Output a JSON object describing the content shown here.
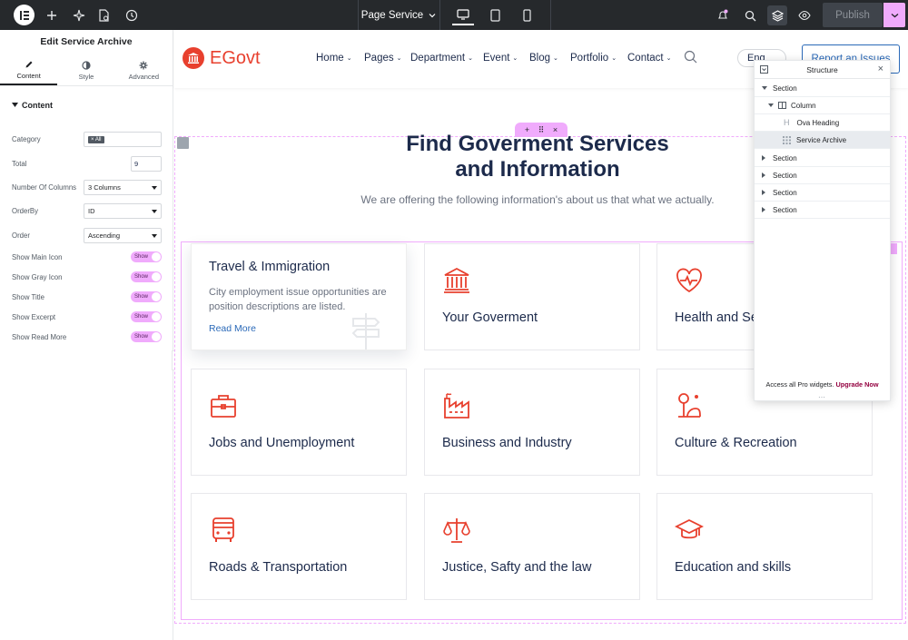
{
  "topbar": {
    "page_name": "Page Service",
    "publish_label": "Publish",
    "icons": [
      "elementor-logo-icon",
      "add-icon",
      "ai-icon",
      "page-settings-icon",
      "history-icon",
      "desktop-icon",
      "tablet-icon",
      "mobile-icon",
      "notifications-icon",
      "search-icon",
      "structure-icon",
      "preview-icon",
      "chevron-down-icon"
    ]
  },
  "panel": {
    "title": "Edit Service Archive",
    "tabs": [
      {
        "label": "Content",
        "icon": "pencil-icon"
      },
      {
        "label": "Style",
        "icon": "contrast-icon"
      },
      {
        "label": "Advanced",
        "icon": "gear-icon"
      }
    ],
    "section_title": "Content",
    "controls": {
      "category": {
        "label": "Category",
        "value": "All"
      },
      "total": {
        "label": "Total",
        "value": "9"
      },
      "columns": {
        "label": "Number Of Columns",
        "value": "3 Columns"
      },
      "orderby": {
        "label": "OrderBy",
        "value": "ID"
      },
      "order": {
        "label": "Order",
        "value": "Ascending"
      },
      "toggles": [
        {
          "label": "Show Main Icon",
          "value": "Show"
        },
        {
          "label": "Show Gray Icon",
          "value": "Show"
        },
        {
          "label": "Show Title",
          "value": "Show"
        },
        {
          "label": "Show Excerpt",
          "value": "Show"
        },
        {
          "label": "Show Read More",
          "value": "Show"
        }
      ]
    }
  },
  "site": {
    "brand": "EGovt",
    "nav": [
      "Home",
      "Pages",
      "Department",
      "Event",
      "Blog",
      "Portfolio",
      "Contact"
    ],
    "lang": "Eng",
    "cta": "Report an Issues",
    "heading_line1": "Find Goverment Services",
    "heading_line2": "and Information",
    "subheading": "We are offering the following information's about us that what we actually.",
    "featured_card": {
      "title": "Travel & Immigration",
      "excerpt": "City employment issue opportunities are position descriptions are listed.",
      "read_more": "Read More"
    },
    "cards": [
      {
        "title": "Your Goverment",
        "icon": "building-icon"
      },
      {
        "title": "Health and Se",
        "icon": "heart-pulse-icon"
      },
      {
        "title": "Jobs and Unemployment",
        "icon": "briefcase-icon"
      },
      {
        "title": "Business and Industry",
        "icon": "factory-icon"
      },
      {
        "title": "Culture & Recreation",
        "icon": "culture-icon"
      },
      {
        "title": "Roads & Transportation",
        "icon": "bus-icon"
      },
      {
        "title": "Justice, Safty and the law",
        "icon": "scales-icon"
      },
      {
        "title": "Education and skills",
        "icon": "graduation-cap-icon"
      }
    ]
  },
  "structure": {
    "title": "Structure",
    "items": [
      "Section",
      "Column",
      "Ova Heading",
      "Service Archive",
      "Section",
      "Section",
      "Section",
      "Section"
    ],
    "footer_text": "Access all Pro widgets.",
    "footer_link": "Upgrade Now"
  },
  "colors": {
    "accent": "#e8402e",
    "navy": "#1c2a4b",
    "link": "#2a69b8",
    "editor_pink": "#f0abfc"
  }
}
